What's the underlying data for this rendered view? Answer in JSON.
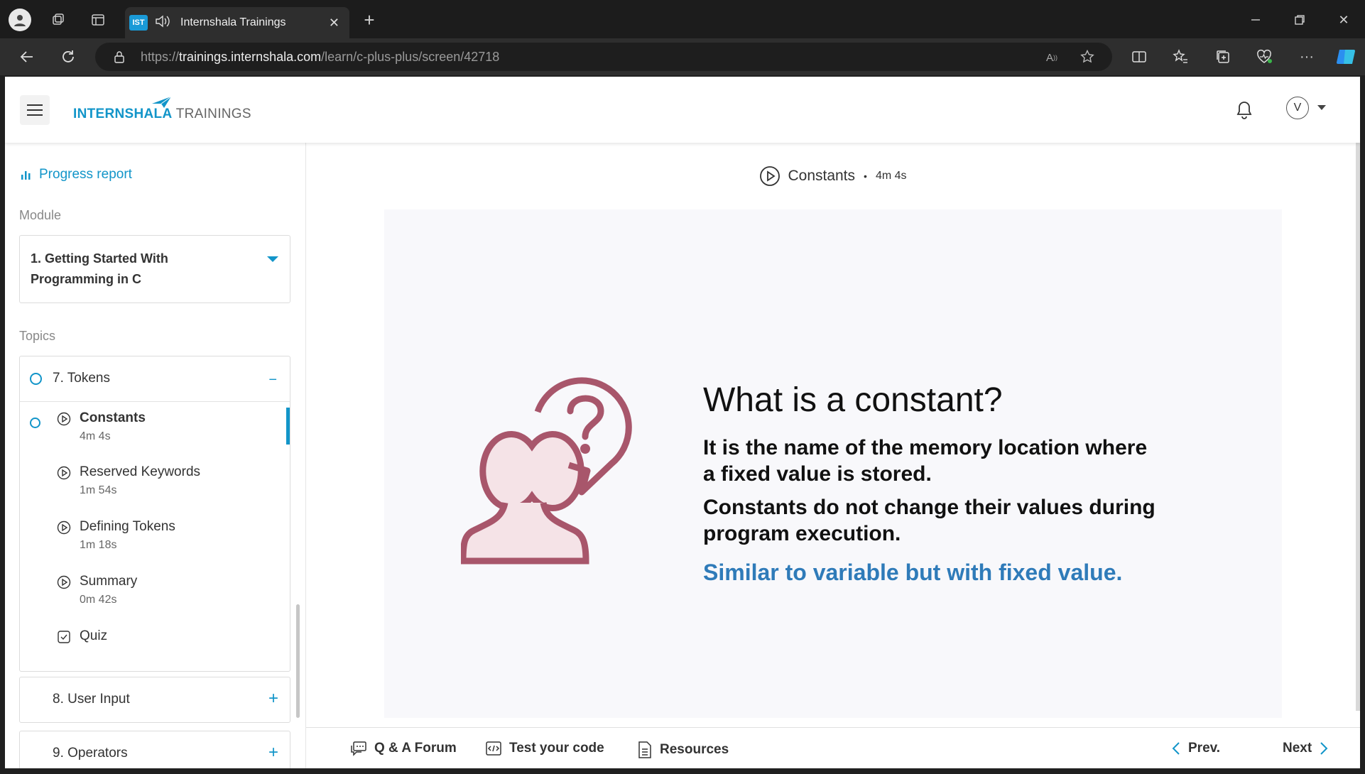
{
  "browser": {
    "tab_title": "Internshala Trainings",
    "favicon_text": "IST",
    "url_prefix": "https://",
    "url_domain": "trainings.internshala.com",
    "url_path": "/learn/c-plus-plus/screen/42718"
  },
  "header": {
    "logo_part1": "INTERNSHALA",
    "logo_part2": " TRAININGS",
    "avatar_letter": "V"
  },
  "sidebar": {
    "progress_label": "Progress report",
    "module_label": "Module",
    "module_selected": "1. Getting Started With Programming in C",
    "topics_label": "Topics",
    "current_topic": "7. Tokens",
    "lessons": [
      {
        "name": "Constants",
        "duration": "4m 4s"
      },
      {
        "name": "Reserved Keywords",
        "duration": "1m 54s"
      },
      {
        "name": "Defining Tokens",
        "duration": "1m 18s"
      },
      {
        "name": "Summary",
        "duration": "0m 42s"
      },
      {
        "name": "Quiz",
        "duration": ""
      }
    ],
    "other_topics": [
      "8. User Input",
      "9. Operators"
    ]
  },
  "main": {
    "lesson_title": "Constants",
    "lesson_duration": "4m 4s",
    "slide": {
      "title": "What is a constant?",
      "para1": "It is the name of the memory location where a fixed value is stored.",
      "para2": "Constants do not change their values during program execution.",
      "highlight": "Similar to variable but with fixed value."
    },
    "footer": {
      "qa": "Q & A Forum",
      "test": "Test your code",
      "resources": "Resources",
      "prev": "Prev.",
      "next": "Next"
    }
  },
  "colors": {
    "brand": "#1295c9",
    "highlight": "#2f7bb9",
    "illustration": "#a8566b"
  }
}
